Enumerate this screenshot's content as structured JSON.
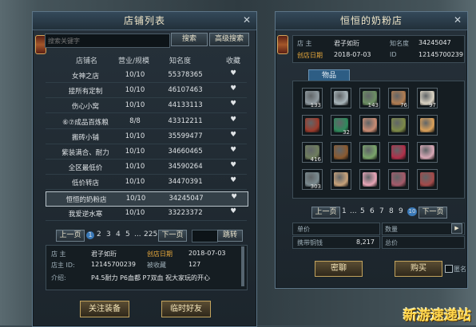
{
  "left_panel": {
    "title": "店铺列表",
    "search_placeholder": "搜索关键字",
    "search_button": "搜索",
    "advanced_search_button": "高级搜索",
    "columns": [
      "店铺名",
      "营业/规模",
      "知名度",
      "收藏"
    ],
    "rows": [
      {
        "name": "女神之店",
        "scale": "10/10",
        "fame": "55378365"
      },
      {
        "name": "接所有定制",
        "scale": "10/10",
        "fame": "46107463"
      },
      {
        "name": "伤心小窝",
        "scale": "10/10",
        "fame": "44133113"
      },
      {
        "name": "⑥⑦成品百炼粮",
        "scale": "8/8",
        "fame": "43312211"
      },
      {
        "name": "搬砖小铺",
        "scale": "10/10",
        "fame": "35599477"
      },
      {
        "name": "紫装满合、耐力",
        "scale": "10/10",
        "fame": "34660465"
      },
      {
        "name": "全区最低价",
        "scale": "10/10",
        "fame": "34590264"
      },
      {
        "name": "低价转店",
        "scale": "10/10",
        "fame": "34470391"
      },
      {
        "name": "恒恒的奶粉店",
        "scale": "10/10",
        "fame": "34245047"
      },
      {
        "name": "我爱逆水寒",
        "scale": "10/10",
        "fame": "33223372"
      }
    ],
    "selected_row": 8,
    "pager": {
      "prev": "上一页",
      "pages": [
        "1",
        "2",
        "3",
        "4",
        "5",
        "...",
        "225"
      ],
      "current": "1",
      "next": "下一页",
      "jump": "跳转"
    },
    "info": {
      "owner_label": "店 主",
      "owner": "君子如珩",
      "created_label": "创店日期",
      "created": "2018-07-03",
      "id_label": "店主 ID:",
      "id": "12145700239",
      "fav_label": "被收藏",
      "fav": "127",
      "intro_label": "介绍:",
      "intro": "P4.5耐力 P6血都 P7双血 祝大家玩的开心"
    },
    "follow_button": "关注装备",
    "friend_button": "临时好友"
  },
  "right_panel": {
    "title": "恒恒的奶粉店",
    "owner_label": "店 主",
    "owner": "君子如珩",
    "fame_label": "知名度",
    "fame": "34245047",
    "created_label": "创店日期",
    "created": "2018-07-03",
    "id_label": "ID",
    "id": "12145700239",
    "tab": "物品",
    "items": [
      {
        "icon": "sword-icon",
        "count": "133",
        "color": "#8f9aa0"
      },
      {
        "icon": "dagger-icon",
        "count": "",
        "color": "#a7b4b9"
      },
      {
        "icon": "blade-icon",
        "count": "143",
        "color": "#6c8f63"
      },
      {
        "icon": "bread-icon",
        "count": "76",
        "color": "#b07d52"
      },
      {
        "icon": "bowl-icon",
        "count": "97",
        "color": "#d9d2c2"
      },
      {
        "icon": "meat-icon",
        "count": "",
        "color": "#9c3b2c"
      },
      {
        "icon": "jade-icon",
        "count": "32",
        "color": "#2f8a5c"
      },
      {
        "icon": "pie-icon",
        "count": "",
        "color": "#c98c74"
      },
      {
        "icon": "herb-icon",
        "count": "",
        "color": "#7d8a48"
      },
      {
        "icon": "dumpling-icon",
        "count": "",
        "color": "#d9a05a"
      },
      {
        "icon": "staff-icon",
        "count": "416",
        "color": "#6f7e5e"
      },
      {
        "icon": "chest-icon",
        "count": "",
        "color": "#8a5a30"
      },
      {
        "icon": "flower-icon",
        "count": "",
        "color": "#7aa46a"
      },
      {
        "icon": "gem-icon",
        "count": "",
        "color": "#b0304a"
      },
      {
        "icon": "ring-icon",
        "count": "",
        "color": "#d8a8b6"
      },
      {
        "icon": "spear-icon",
        "count": "303",
        "color": "#7a8a8f"
      },
      {
        "icon": "scroll-icon",
        "count": "",
        "color": "#c7a27a"
      },
      {
        "icon": "blossom-icon",
        "count": "",
        "color": "#e6a4b6"
      },
      {
        "icon": "charm-icon",
        "count": "",
        "color": "#a35a6a"
      },
      {
        "icon": "boot-icon",
        "count": "",
        "color": "#a34a4a"
      }
    ],
    "pager": {
      "prev": "上一页",
      "pages": [
        "1",
        "...",
        "5",
        "6",
        "7",
        "8",
        "9",
        "10"
      ],
      "current": "10",
      "next": "下一页"
    },
    "price_label": "单价",
    "qty_label": "数量",
    "money_label": "携带铜钱",
    "money": "8,217",
    "total_label": "总价",
    "whisper_button": "密聊",
    "buy_button": "购买",
    "anon_label": "匿名"
  },
  "watermark": "新游速递站"
}
